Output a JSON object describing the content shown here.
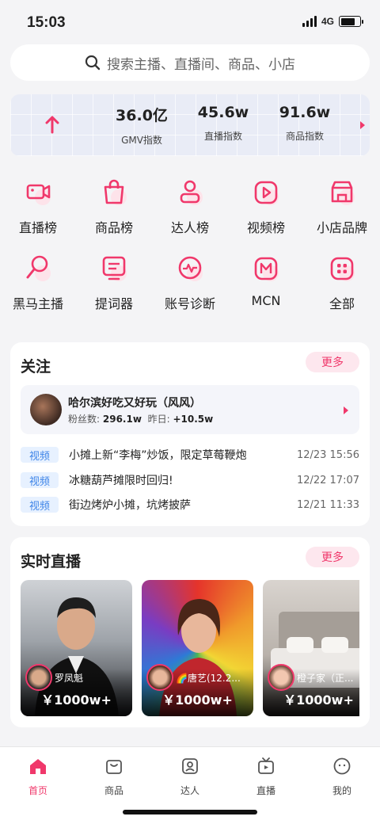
{
  "status_bar": {
    "time": "15:03",
    "network": "4G"
  },
  "search": {
    "placeholder": "搜索主播、直播间、商品、小店"
  },
  "index_stats": [
    {
      "value": "36.0亿",
      "label": "GMV指数"
    },
    {
      "value": "45.6w",
      "label": "直播指数"
    },
    {
      "value": "91.6w",
      "label": "商品指数"
    }
  ],
  "tools": [
    {
      "label": "直播榜",
      "icon": "live-camera-icon"
    },
    {
      "label": "商品榜",
      "icon": "shopping-bag-icon"
    },
    {
      "label": "达人榜",
      "icon": "person-icon"
    },
    {
      "label": "视频榜",
      "icon": "video-play-icon"
    },
    {
      "label": "小店品牌",
      "icon": "store-icon"
    },
    {
      "label": "黑马主播",
      "icon": "search-anchor-icon"
    },
    {
      "label": "提词器",
      "icon": "teleprompter-icon"
    },
    {
      "label": "账号诊断",
      "icon": "pulse-icon"
    },
    {
      "label": "MCN",
      "icon": "mcn-icon"
    },
    {
      "label": "全部",
      "icon": "grid-icon"
    }
  ],
  "follow": {
    "title": "关注",
    "more": "更多",
    "account": {
      "name": "哈尔滨好吃又好玩（风风）",
      "fans_label": "粉丝数:",
      "fans_value": "296.1w",
      "yesterday_label": "昨日:",
      "yesterday_value": "+10.5w"
    },
    "videos": [
      {
        "tag": "视频",
        "title": "小摊上新“李梅”炒饭，限定草莓鞭炮",
        "time": "12/23 15:56"
      },
      {
        "tag": "视频",
        "title": "冰糖葫芦摊限时回归!",
        "time": "12/22 17:07"
      },
      {
        "tag": "视频",
        "title": "街边烤炉小摊，坑烤披萨",
        "time": "12/21 11:33"
      }
    ]
  },
  "live": {
    "title": "实时直播",
    "more": "更多",
    "streams": [
      {
        "name": "罗凤魁",
        "value": "￥1000w+"
      },
      {
        "name": "🌈唐艺(12.2...",
        "value": "￥1000w+"
      },
      {
        "name": "橙子家（正...",
        "value": "￥1000w+"
      }
    ]
  },
  "tab_bar": {
    "tabs": [
      {
        "label": "首页",
        "icon": "home-icon",
        "active": true
      },
      {
        "label": "商品",
        "icon": "shopping-bag-icon"
      },
      {
        "label": "达人",
        "icon": "person-card-icon"
      },
      {
        "label": "直播",
        "icon": "tv-icon"
      },
      {
        "label": "我的",
        "icon": "profile-face-icon"
      }
    ]
  },
  "colors": {
    "accent": "#f0386b",
    "tag_blue": "#3d84e8",
    "background": "#f4f4f6"
  }
}
